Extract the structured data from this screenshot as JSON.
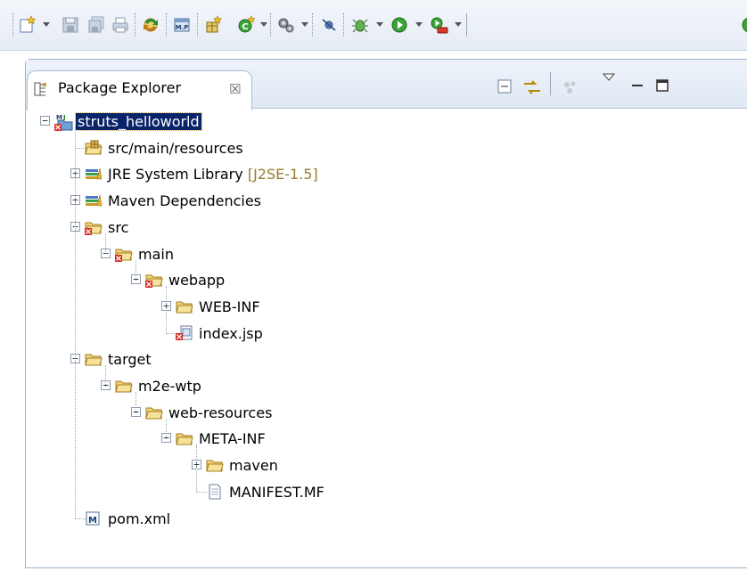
{
  "toolbar": {
    "buttons": [
      {
        "name": "new-wizard-icon",
        "dropdown": true
      },
      {
        "name": "save-icon",
        "dropdown": false
      },
      {
        "name": "save-all-icon",
        "dropdown": false
      },
      {
        "name": "print-icon",
        "dropdown": false
      },
      {
        "name": "sync-icon",
        "dropdown": false
      },
      {
        "name": "maven-icon",
        "dropdown": false
      },
      {
        "name": "new-java-package-icon",
        "dropdown": false
      },
      {
        "name": "new-java-class-icon",
        "dropdown": true
      },
      {
        "name": "external-tools-icon",
        "dropdown": true
      },
      {
        "name": "skip-breakpoints-icon",
        "dropdown": false
      },
      {
        "name": "debug-icon",
        "dropdown": true
      },
      {
        "name": "run-icon",
        "dropdown": true
      },
      {
        "name": "run-server-icon",
        "dropdown": true
      }
    ]
  },
  "view": {
    "tab_label": "Package Explorer",
    "tab_close_glyph": "☒",
    "header_icons": [
      "collapse-all-icon",
      "link-with-editor-icon",
      "focus-icon",
      "view-menu-icon",
      "minimize-icon",
      "maximize-icon"
    ]
  },
  "tree": [
    {
      "label": "struts_helloworld",
      "icon": "maven-project-icon",
      "level": 0,
      "toggle": "-",
      "selected": true
    },
    {
      "label": "src/main/resources",
      "icon": "source-folder-icon",
      "level": 1,
      "toggle": null
    },
    {
      "label": "JRE System Library",
      "decoration": "[J2SE-1.5]",
      "icon": "library-icon",
      "level": 1,
      "toggle": "+"
    },
    {
      "label": "Maven Dependencies",
      "icon": "library-icon",
      "level": 1,
      "toggle": "+"
    },
    {
      "label": "src",
      "icon": "folder-error-icon",
      "level": 1,
      "toggle": "-"
    },
    {
      "label": "main",
      "icon": "folder-error-icon",
      "level": 2,
      "toggle": "-"
    },
    {
      "label": "webapp",
      "icon": "folder-error-icon",
      "level": 3,
      "toggle": "-"
    },
    {
      "label": "WEB-INF",
      "icon": "folder-icon",
      "level": 4,
      "toggle": "+"
    },
    {
      "label": "index.jsp",
      "icon": "jsp-file-error-icon",
      "level": 4,
      "toggle": null
    },
    {
      "label": "target",
      "icon": "folder-icon",
      "level": 1,
      "toggle": "-"
    },
    {
      "label": "m2e-wtp",
      "icon": "folder-icon",
      "level": 2,
      "toggle": "-"
    },
    {
      "label": "web-resources",
      "icon": "folder-icon",
      "level": 3,
      "toggle": "-"
    },
    {
      "label": "META-INF",
      "icon": "folder-icon",
      "level": 4,
      "toggle": "-"
    },
    {
      "label": "maven",
      "icon": "folder-icon",
      "level": 5,
      "toggle": "+"
    },
    {
      "label": "MANIFEST.MF",
      "icon": "text-file-icon",
      "level": 5,
      "toggle": null
    },
    {
      "label": "pom.xml",
      "icon": "maven-pom-icon",
      "level": 1,
      "toggle": null
    }
  ]
}
